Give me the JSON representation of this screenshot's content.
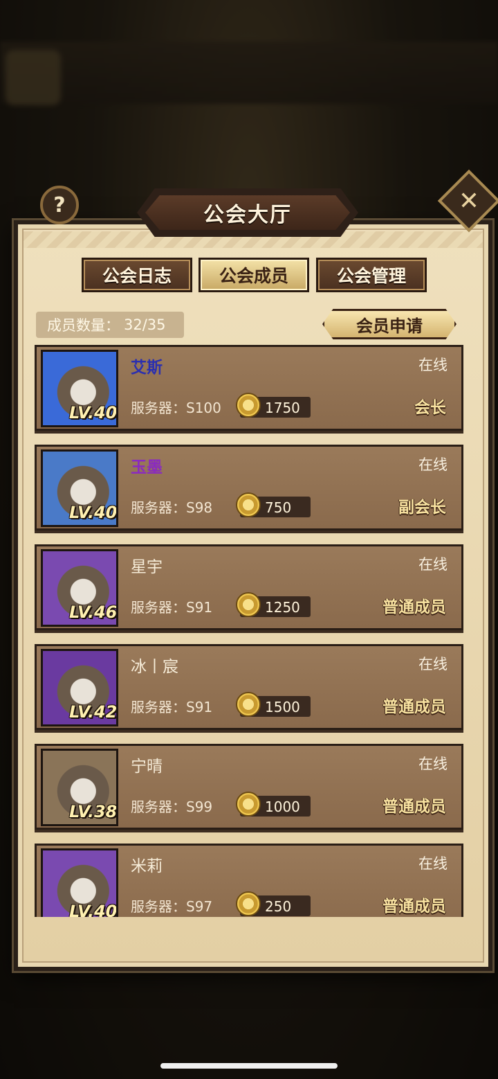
{
  "header": {
    "title": "公会大厅",
    "help_icon": "question-icon",
    "close_icon": "close-icon"
  },
  "tabs": [
    {
      "label": "公会日志",
      "active": false
    },
    {
      "label": "公会成员",
      "active": true
    },
    {
      "label": "公会管理",
      "active": false
    }
  ],
  "member_count": {
    "label": "成员数量：",
    "value": "32/35"
  },
  "apply_button": "会员申请",
  "members": [
    {
      "name": "艾斯",
      "name_color": "#2b2fb0",
      "level": "LV.40",
      "server": "服务器：S100",
      "coins": "1750",
      "status": "在线",
      "role": "会长",
      "avatar_border": "#3a6ad8"
    },
    {
      "name": "玉墨",
      "name_color": "#8a2ac0",
      "level": "LV.40",
      "server": "服务器：S98",
      "coins": "750",
      "status": "在线",
      "role": "副会长",
      "avatar_border": "#4a7ac8"
    },
    {
      "name": "星宇",
      "name_color": "#f6ecd8",
      "level": "LV.46",
      "server": "服务器：S91",
      "coins": "1250",
      "status": "在线",
      "role": "普通成员",
      "avatar_border": "#7a4ab0"
    },
    {
      "name": "冰丨宸",
      "name_color": "#f6ecd8",
      "level": "LV.42",
      "server": "服务器：S91",
      "coins": "1500",
      "status": "在线",
      "role": "普通成员",
      "avatar_border": "#6a3aa0"
    },
    {
      "name": "宁晴",
      "name_color": "#f6ecd8",
      "level": "LV.38",
      "server": "服务器：S99",
      "coins": "1000",
      "status": "在线",
      "role": "普通成员",
      "avatar_border": "#8a7458"
    },
    {
      "name": "米莉",
      "name_color": "#f6ecd8",
      "level": "LV.40",
      "server": "服务器：S97",
      "coins": "250",
      "status": "在线",
      "role": "普通成员",
      "avatar_border": "#7a4ab0"
    }
  ]
}
